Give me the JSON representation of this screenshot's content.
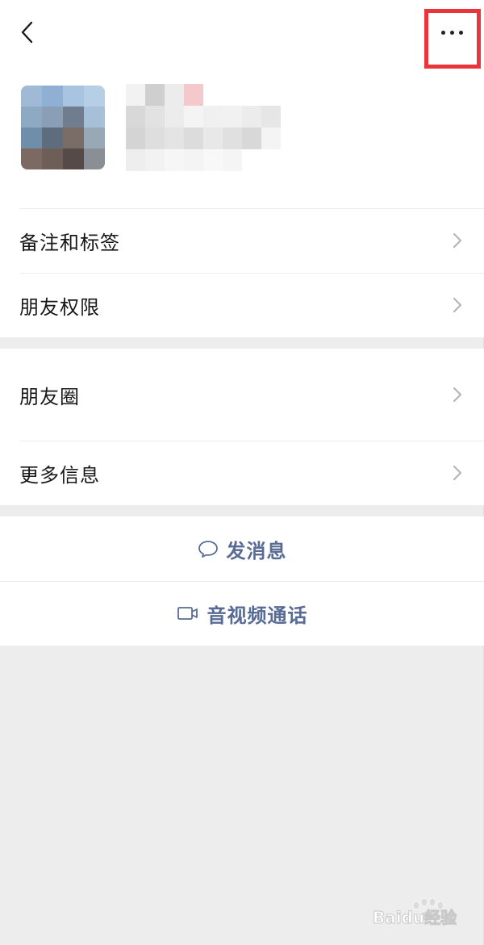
{
  "header": {
    "back_icon": "chevron-left-icon",
    "more_icon": "more-dots-icon",
    "highlight_color": "#e8343a"
  },
  "profile": {
    "avatar_pixelated": true,
    "name_pixelated": true
  },
  "menu_group_1": [
    {
      "label": "备注和标签"
    },
    {
      "label": "朋友权限"
    }
  ],
  "menu_group_2": [
    {
      "label": "朋友圈"
    },
    {
      "label": "更多信息"
    }
  ],
  "actions": [
    {
      "label": "发消息",
      "icon": "chat-bubble-icon"
    },
    {
      "label": "音视频通话",
      "icon": "video-camera-icon"
    }
  ],
  "colors": {
    "background": "#ededed",
    "card": "#ffffff",
    "link_blue": "#576b95",
    "text": "#181818"
  },
  "watermark": {
    "text": "Baidu经验"
  }
}
